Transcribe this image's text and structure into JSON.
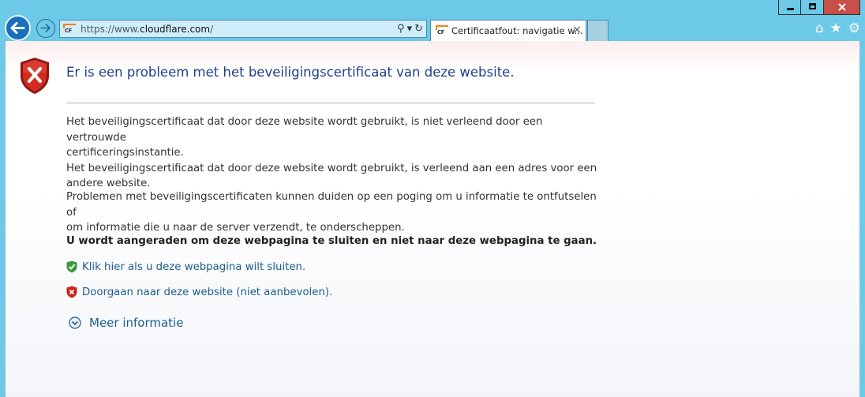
{
  "browser": {
    "url_prefix": "https://www.",
    "url_host": "cloudflare.com",
    "url_suffix": "/",
    "tab_title": "Certificaatfout: navigatie w...",
    "tab_close": "×",
    "logo_text": "CF"
  },
  "icons": {
    "back": "back-arrow-icon",
    "forward": "forward-arrow-icon",
    "search": "⚲",
    "dropdown": "▾",
    "refresh": "↻",
    "home": "⌂",
    "favorites": "★",
    "settings": "⚙"
  },
  "colors": {
    "chrome": "#6dc9e8",
    "close_button": "#c7504a",
    "heading": "#20418a",
    "link": "#1a5d8c"
  },
  "page": {
    "heading": "Er is een probleem met het beveiligingscertificaat van deze website.",
    "para1_line1": "Het beveiligingscertificaat dat door deze website wordt gebruikt, is niet verleend door een vertrouwde",
    "para1_line2": "certificeringsinstantie.",
    "para1_line3": "Het beveiligingscertificaat dat door deze website wordt gebruikt, is verleend aan een adres voor een",
    "para1_line4": "andere website.",
    "para2_line1": "Problemen met beveiligingscertificaten kunnen duiden op een poging om u informatie te ontfutselen of",
    "para2_line2": "om informatie die u naar de server verzendt, te onderscheppen.",
    "warning": "U wordt aangeraden om deze webpagina te sluiten en niet naar deze webpagina te gaan.",
    "close_link": "Klik hier als u deze webpagina wilt sluiten.",
    "continue_link": "Doorgaan naar deze website (niet aanbevolen).",
    "more_info": "Meer informatie"
  }
}
